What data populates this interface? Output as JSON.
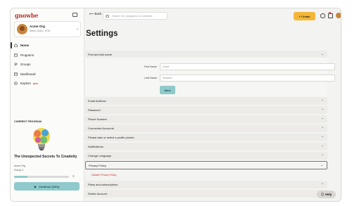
{
  "brand": {
    "logo": "ɡnowbe"
  },
  "org": {
    "name": "Acme Org",
    "meta": "Demo (1161)  ·  ₴ 34"
  },
  "nav": [
    {
      "label": "Home",
      "icon": "home-icon",
      "active": true
    },
    {
      "label": "Programs",
      "icon": "programs-icon"
    },
    {
      "label": "Groups",
      "icon": "groups-icon"
    },
    {
      "label": "Dashboard",
      "icon": "dashboard-icon"
    },
    {
      "label": "Explore",
      "icon": "explore-icon",
      "badge": "BETA"
    }
  ],
  "current_program": {
    "section_label": "CURRENT PROGRAM",
    "title": "The Unexpected Secrets To Creativity",
    "org": "Acme Org",
    "group": "Group 4",
    "progress": 0.24,
    "continue_label": "Continue (24%)"
  },
  "header": {
    "back_label": "Back",
    "search_placeholder": "Search for programs or contents",
    "create_label": "+ Create"
  },
  "page": {
    "title": "Settings"
  },
  "sections": {
    "name": "First and last name",
    "first_name_label": "First Name",
    "first_name_value": "Circe",
    "last_name_label": "Last Name",
    "last_name_value": "Schoen",
    "save_label": "Save",
    "list": [
      "Email Address",
      "Password",
      "Phone Number",
      "Connected Accounts",
      "Please take or select a profile picture",
      "Notifications",
      "Change Language"
    ],
    "privacy": "Privacy Policy",
    "disable_privacy": "Disable Privacy Policy",
    "plans": "Plans and subscriptions",
    "delete": "Delete Account"
  },
  "help_label": "Help",
  "colors": {
    "accent": "#8fc9cb",
    "create": "#f3b738",
    "brand": "#b2332f"
  }
}
